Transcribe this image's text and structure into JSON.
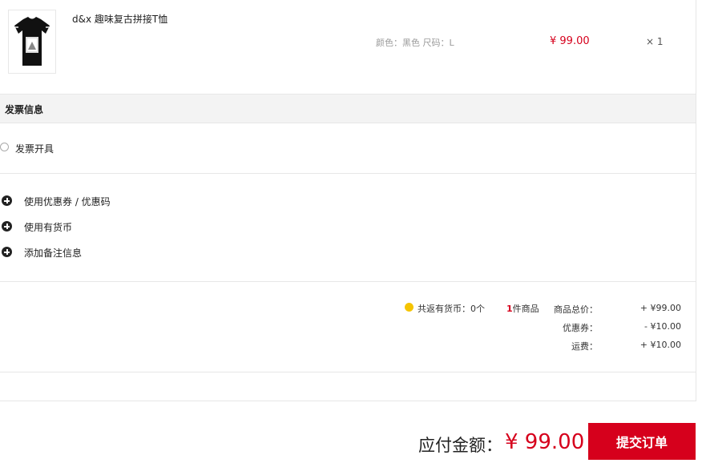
{
  "product": {
    "name": "d&x 趣味复古拼接T恤",
    "spec": "颜色：黑色  尺码：L",
    "price": "¥ 99.00",
    "qty": "× 1",
    "thumb_icon": "tshirt-icon"
  },
  "invoice": {
    "header": "发票信息",
    "option_label": "发票开具"
  },
  "options": [
    {
      "icon": "plus-circle-icon",
      "label": "使用优惠券 / 优惠码"
    },
    {
      "icon": "plus-circle-icon",
      "label": "使用有货币"
    },
    {
      "icon": "plus-circle-icon",
      "label": "添加备注信息"
    }
  ],
  "summary": {
    "coin_icon": "coin-icon",
    "coin_text": "共返有货币：0个",
    "count_number": "1",
    "count_text": "件商品",
    "rows": [
      {
        "label": "商品总价：",
        "value": "+ ¥99.00"
      },
      {
        "label": "优惠券：",
        "value": "- ¥10.00"
      },
      {
        "label": "运费：",
        "value": "+ ¥10.00"
      }
    ]
  },
  "footer": {
    "pay_label": "应付金额：",
    "pay_amount": "¥ 99.00",
    "submit_label": "提交订单"
  },
  "colors": {
    "accent": "#d6001c",
    "coin": "#f5c400"
  }
}
